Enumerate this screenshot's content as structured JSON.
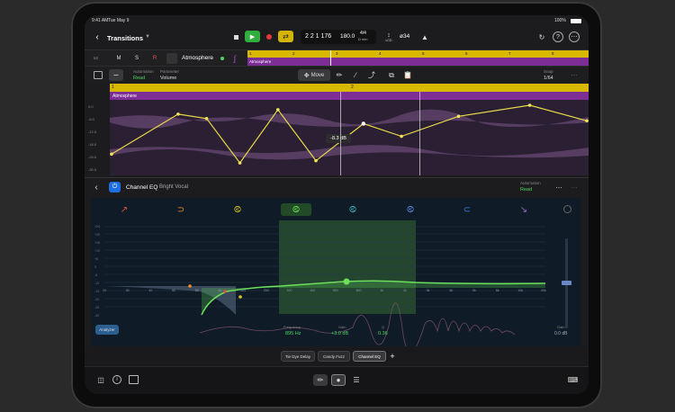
{
  "status": {
    "time": "9:41 AM",
    "date": "Tue May 9",
    "battery": "100%"
  },
  "topbar": {
    "title": "Transitions",
    "position": "2 2 1 176",
    "tempo": "180.0",
    "signature_top": "4/4",
    "signature_bottom": "D min",
    "lcd_label": "LCD",
    "count": "ø34"
  },
  "track": {
    "number": "52",
    "mute": "M",
    "solo": "S",
    "record": "R",
    "name": "Atmosphere",
    "region_name": "Atmosphere",
    "ruler": [
      "1",
      "2",
      "3",
      "4",
      "5",
      "6",
      "7",
      "8"
    ]
  },
  "automation": {
    "mode_label": "Automation",
    "mode_value": "Read",
    "parameter_label": "Parameter",
    "parameter_value": "Volume",
    "move_label": "Move",
    "snap_label": "Snap",
    "snap_value": "1/64",
    "tooltip": "-8.3 dB",
    "region_name": "Atmosphere",
    "ruler": [
      "1",
      "2"
    ],
    "level": [
      "0.0",
      "-6.0",
      "-12.0",
      "-18.0",
      "-24.0",
      "-30.0"
    ],
    "points": [
      {
        "x": 0.0,
        "y": -22
      },
      {
        "x": 0.14,
        "y": -4
      },
      {
        "x": 0.2,
        "y": -6
      },
      {
        "x": 0.27,
        "y": -26
      },
      {
        "x": 0.35,
        "y": -2
      },
      {
        "x": 0.43,
        "y": -25
      },
      {
        "x": 0.53,
        "y": -8.3
      },
      {
        "x": 0.61,
        "y": -14
      },
      {
        "x": 0.73,
        "y": -5
      },
      {
        "x": 0.88,
        "y": 0
      },
      {
        "x": 1.0,
        "y": -7
      }
    ]
  },
  "eq": {
    "plugin_name": "Channel EQ",
    "preset": "Bright Vocal",
    "automation_label": "Automation",
    "automation_value": "Read",
    "db_labels": [
      "+24",
      "+20",
      "+15",
      "+10",
      "+5",
      "0",
      "-5",
      "-10",
      "-15",
      "-20",
      "-25",
      "-30"
    ],
    "freq_labels": [
      "20",
      "30",
      "40",
      "50",
      "60",
      "80",
      "100",
      "200",
      "300",
      "400",
      "500",
      "800",
      "1k",
      "2k",
      "3k",
      "4k",
      "5k",
      "8k",
      "10k",
      "20k"
    ],
    "analyzer_label": "Analyzer",
    "frequency_label": "Frequency",
    "frequency_value": "895 Hz",
    "gain_label": "Gain",
    "gain_value": "+3.0 dB",
    "q_label": "Q",
    "q_value": "0.36",
    "gain_knob_label": "Gain",
    "gain_knob_value": "0.0 dB",
    "bands": [
      "high-cut-band",
      "low-shelf-band",
      "low-mid-band",
      "mid-band-1",
      "mid-band-2",
      "high-mid-band",
      "high-shelf-band",
      "high-pass-band"
    ],
    "colors": {
      "selected": "#54d04a",
      "curve": "#4caf50",
      "band_fill": "#3e7d3a"
    }
  },
  "plugins": [
    "Tie Dye Delay",
    "Candy Fuzz",
    "Channel EQ"
  ],
  "add_plugin": "+"
}
